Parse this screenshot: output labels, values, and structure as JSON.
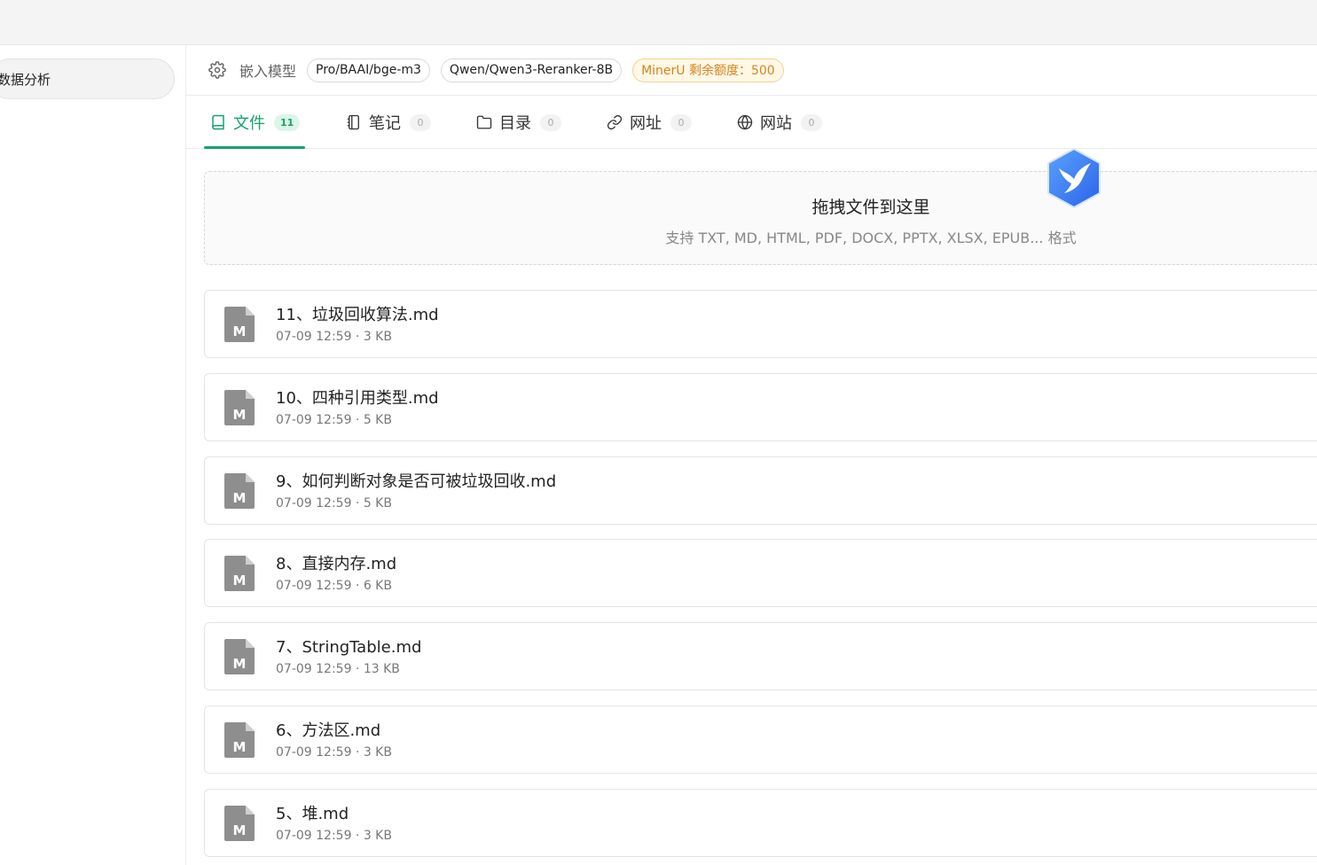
{
  "sidebar": {
    "items": [
      {
        "label": "数据分析"
      }
    ]
  },
  "toolbar": {
    "settings_icon": "gear-icon",
    "label": "嵌入模型",
    "embedding_model": "Pro/BAAI/bge-m3",
    "reranker_model": "Qwen/Qwen3-Reranker-8B",
    "quota": "MinerU 剩余额度：500",
    "quota_color": "#d4841a"
  },
  "tabs": [
    {
      "label": "文件",
      "count": "11",
      "icon": "book-icon",
      "active": true
    },
    {
      "label": "笔记",
      "count": "0",
      "icon": "notebook-icon",
      "active": false
    },
    {
      "label": "目录",
      "count": "0",
      "icon": "folder-icon",
      "active": false
    },
    {
      "label": "网址",
      "count": "0",
      "icon": "link-icon",
      "active": false
    },
    {
      "label": "网站",
      "count": "0",
      "icon": "globe-icon",
      "active": false
    }
  ],
  "accent_color": "#16a369",
  "dropzone": {
    "title": "拖拽文件到这里",
    "subtitle": "支持 TXT, MD, HTML, PDF, DOCX, PPTX, XLSX, EPUB... 格式"
  },
  "files": [
    {
      "name": "11、垃圾回收算法.md",
      "meta": "07-09 12:59 · 3 KB",
      "icon": "markdown-file-icon"
    },
    {
      "name": "10、四种引用类型.md",
      "meta": "07-09 12:59 · 5 KB",
      "icon": "markdown-file-icon"
    },
    {
      "name": "9、如何判断对象是否可被垃圾回收.md",
      "meta": "07-09 12:59 · 5 KB",
      "icon": "markdown-file-icon"
    },
    {
      "name": "8、直接内存.md",
      "meta": "07-09 12:59 · 6 KB",
      "icon": "markdown-file-icon"
    },
    {
      "name": "7、StringTable.md",
      "meta": "07-09 12:59 · 13 KB",
      "icon": "markdown-file-icon"
    },
    {
      "name": "6、方法区.md",
      "meta": "07-09 12:59 · 3 KB",
      "icon": "markdown-file-icon"
    },
    {
      "name": "5、堆.md",
      "meta": "07-09 12:59 · 3 KB",
      "icon": "markdown-file-icon"
    }
  ],
  "file_icon_letter": "M"
}
